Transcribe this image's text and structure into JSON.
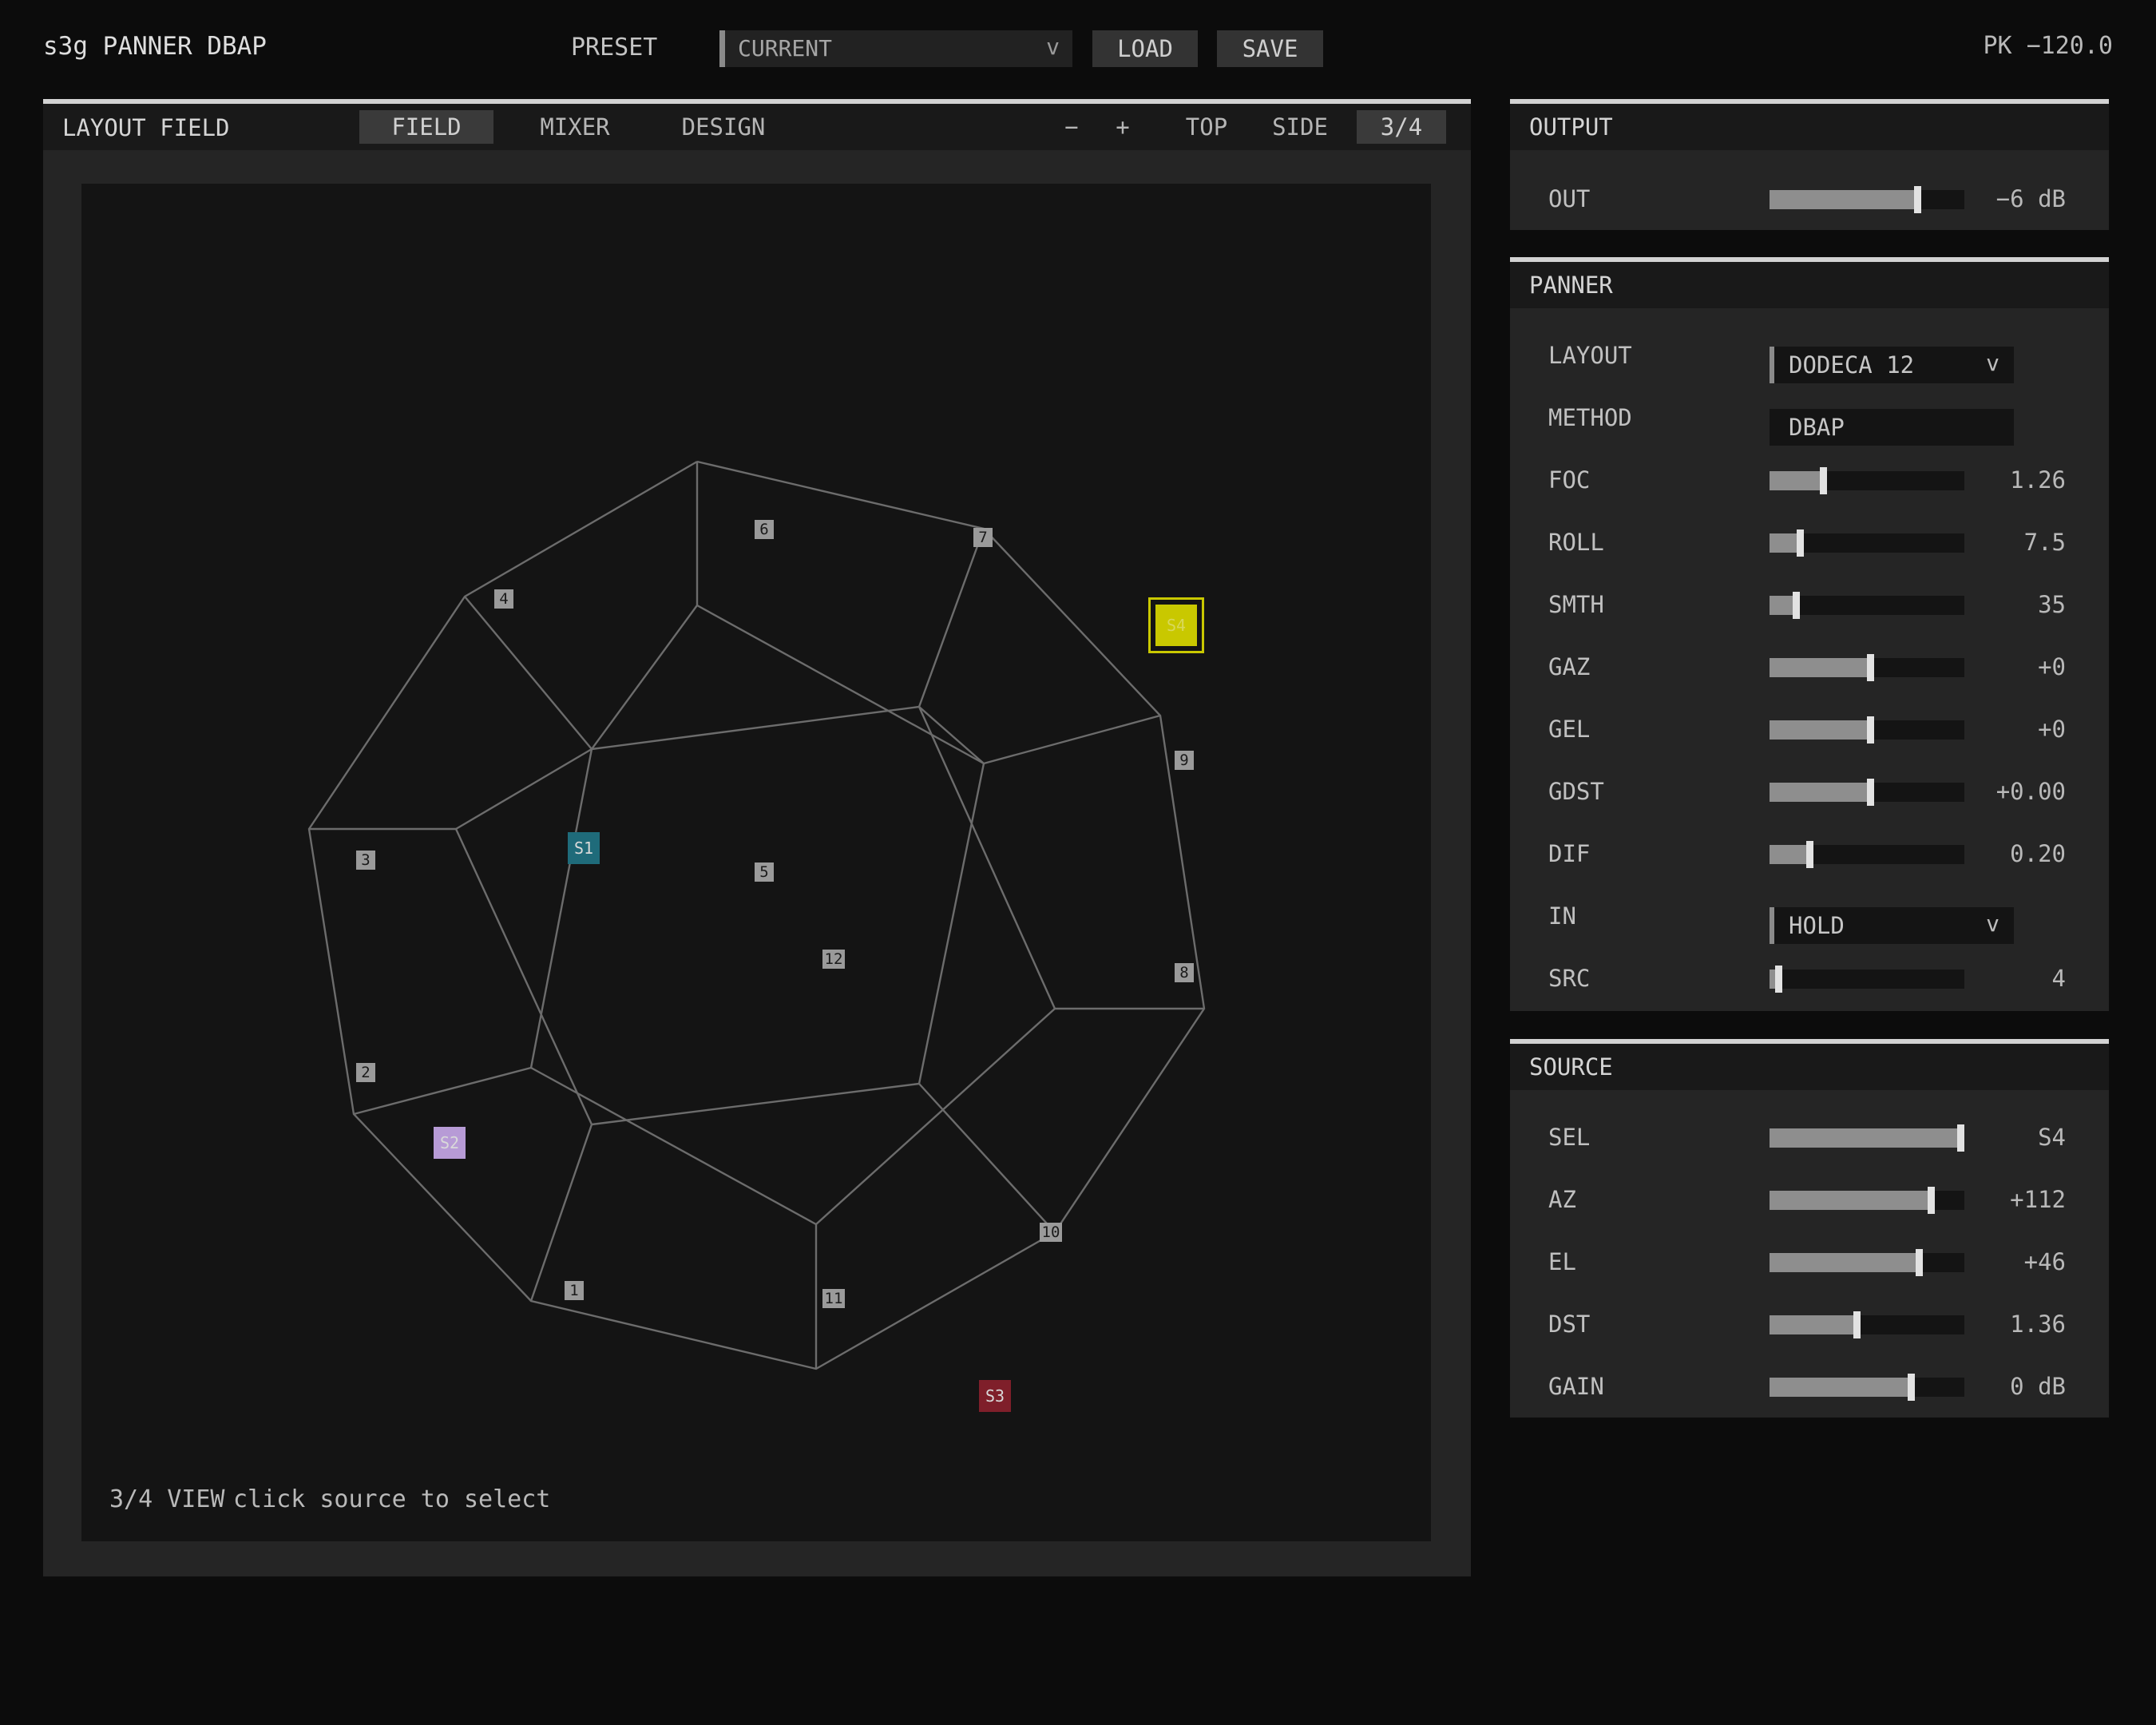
{
  "app": {
    "title": "s3g PANNER DBAP",
    "peak": "PK −120.0"
  },
  "preset": {
    "label": "PRESET",
    "value": "CURRENT",
    "chevron": "v",
    "load": "LOAD",
    "save": "SAVE"
  },
  "field": {
    "title": "LAYOUT FIELD",
    "tabs": [
      "FIELD",
      "MIXER",
      "DESIGN"
    ],
    "active_tab": "FIELD",
    "zoom_out": "−",
    "zoom_in": "+",
    "views": [
      "TOP",
      "SIDE",
      "3/4"
    ],
    "active_view": "3/4",
    "hint_view": "3/4 VIEW",
    "hint_text": "click source to select",
    "speakers": [
      "1",
      "2",
      "3",
      "4",
      "5",
      "6",
      "7",
      "8",
      "9",
      "10",
      "11",
      "12"
    ],
    "sources": [
      {
        "label": "S1",
        "color": "#1f6b7a"
      },
      {
        "label": "S2",
        "color": "#b79bd6"
      },
      {
        "label": "S3",
        "color": "#7f1f2a"
      },
      {
        "label": "S4",
        "color": "#c9c800",
        "selected": true
      }
    ]
  },
  "output": {
    "title": "OUTPUT",
    "rows": [
      {
        "label": "OUT",
        "value": "−6 dB",
        "level": 0.74
      }
    ]
  },
  "panner": {
    "title": "PANNER",
    "layout": {
      "label": "LAYOUT",
      "value": "DODECA 12",
      "chevron": "v"
    },
    "method": {
      "label": "METHOD",
      "value": "DBAP"
    },
    "sliders": [
      {
        "label": "FOC",
        "value": "1.26",
        "level": 0.26
      },
      {
        "label": "ROLL",
        "value": "7.5",
        "level": 0.14
      },
      {
        "label": "SMTH",
        "value": "35",
        "level": 0.12
      },
      {
        "label": "GAZ",
        "value": "+0",
        "level": 0.5
      },
      {
        "label": "GEL",
        "value": "+0",
        "level": 0.5
      },
      {
        "label": "GDST",
        "value": "+0.00",
        "level": 0.5
      },
      {
        "label": "DIF",
        "value": "0.20",
        "level": 0.19
      }
    ],
    "input": {
      "label": "IN",
      "value": "HOLD",
      "chevron": "v"
    },
    "src": {
      "label": "SRC",
      "value": "4",
      "level": 0.03
    }
  },
  "source": {
    "title": "SOURCE",
    "sliders": [
      {
        "label": "SEL",
        "value": "S4",
        "level": 0.99
      },
      {
        "label": "AZ",
        "value": "+112",
        "level": 0.81
      },
      {
        "label": "EL",
        "value": "+46",
        "level": 0.75
      },
      {
        "label": "DST",
        "value": "1.36",
        "level": 0.43
      },
      {
        "label": "GAIN",
        "value": "0 dB",
        "level": 0.71
      }
    ]
  }
}
